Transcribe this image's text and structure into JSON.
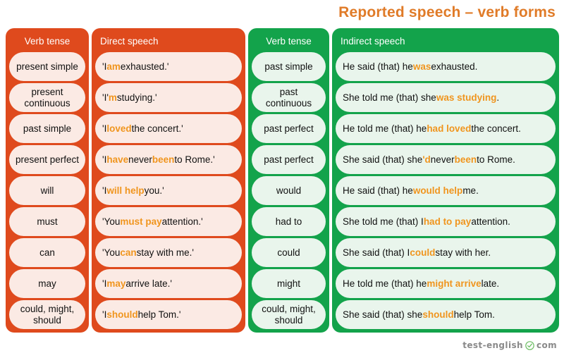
{
  "title": "Reported speech – verb forms",
  "colors": {
    "orange_panel": "#DF4A1D",
    "green_panel": "#13A34B",
    "pink_pill": "#FBEAE4",
    "mint_pill": "#E9F5EC",
    "highlight": "#F0951E",
    "title_text": "#E07B28",
    "footer_text": "#8A8A8A"
  },
  "columns": {
    "direct_tense_header": "Verb tense",
    "direct_speech_header": "Direct speech",
    "indirect_tense_header": "Verb tense",
    "indirect_speech_header": "Indirect speech"
  },
  "rows": [
    {
      "direct_tense": "present simple",
      "direct_speech": [
        {
          "t": "'I ",
          "h": false
        },
        {
          "t": "am",
          "h": true
        },
        {
          "t": " exhausted.'",
          "h": false
        }
      ],
      "indirect_tense": "past simple",
      "indirect_speech": [
        {
          "t": "He said (that) he ",
          "h": false
        },
        {
          "t": "was",
          "h": true
        },
        {
          "t": " exhausted.",
          "h": false
        }
      ]
    },
    {
      "direct_tense": "present continuous",
      "direct_speech": [
        {
          "t": "'I'",
          "h": false
        },
        {
          "t": "m",
          "h": true
        },
        {
          "t": " studying.'",
          "h": false
        }
      ],
      "indirect_tense": "past continuous",
      "indirect_speech": [
        {
          "t": "She told me (that) she ",
          "h": false
        },
        {
          "t": "was studying",
          "h": true
        },
        {
          "t": ".",
          "h": false
        }
      ]
    },
    {
      "direct_tense": "past simple",
      "direct_speech": [
        {
          "t": "'I ",
          "h": false
        },
        {
          "t": "loved",
          "h": true
        },
        {
          "t": " the concert.'",
          "h": false
        }
      ],
      "indirect_tense": "past perfect",
      "indirect_speech": [
        {
          "t": "He told me (that) he ",
          "h": false
        },
        {
          "t": "had loved",
          "h": true
        },
        {
          "t": " the concert.",
          "h": false
        }
      ]
    },
    {
      "direct_tense": "present perfect",
      "direct_speech": [
        {
          "t": "'I ",
          "h": false
        },
        {
          "t": "have",
          "h": true
        },
        {
          "t": " never ",
          "h": false
        },
        {
          "t": "been",
          "h": true
        },
        {
          "t": " to Rome.'",
          "h": false
        }
      ],
      "indirect_tense": "past perfect",
      "indirect_speech": [
        {
          "t": "She said (that) she",
          "h": false
        },
        {
          "t": "'d",
          "h": true
        },
        {
          "t": " never ",
          "h": false
        },
        {
          "t": "been",
          "h": true
        },
        {
          "t": " to Rome.",
          "h": false
        }
      ]
    },
    {
      "direct_tense": "will",
      "direct_speech": [
        {
          "t": "'I ",
          "h": false
        },
        {
          "t": "will help",
          "h": true
        },
        {
          "t": " you.'",
          "h": false
        }
      ],
      "indirect_tense": "would",
      "indirect_speech": [
        {
          "t": "He said (that) he ",
          "h": false
        },
        {
          "t": "would help",
          "h": true
        },
        {
          "t": " me.",
          "h": false
        }
      ]
    },
    {
      "direct_tense": "must",
      "direct_speech": [
        {
          "t": "'You ",
          "h": false
        },
        {
          "t": "must pay",
          "h": true
        },
        {
          "t": " attention.'",
          "h": false
        }
      ],
      "indirect_tense": "had to",
      "indirect_speech": [
        {
          "t": "She told me (that) I ",
          "h": false
        },
        {
          "t": "had to pay",
          "h": true
        },
        {
          "t": " attention.",
          "h": false
        }
      ]
    },
    {
      "direct_tense": "can",
      "direct_speech": [
        {
          "t": "'You ",
          "h": false
        },
        {
          "t": "can",
          "h": true
        },
        {
          "t": " stay with me.'",
          "h": false
        }
      ],
      "indirect_tense": "could",
      "indirect_speech": [
        {
          "t": "She said (that) I ",
          "h": false
        },
        {
          "t": "could",
          "h": true
        },
        {
          "t": " stay with her.",
          "h": false
        }
      ]
    },
    {
      "direct_tense": "may",
      "direct_speech": [
        {
          "t": "'I ",
          "h": false
        },
        {
          "t": "may",
          "h": true
        },
        {
          "t": " arrive late.'",
          "h": false
        }
      ],
      "indirect_tense": "might",
      "indirect_speech": [
        {
          "t": "He told me (that) he ",
          "h": false
        },
        {
          "t": "might arrive",
          "h": true
        },
        {
          "t": " late.",
          "h": false
        }
      ]
    },
    {
      "direct_tense": "could, might, should",
      "direct_speech": [
        {
          "t": "'I ",
          "h": false
        },
        {
          "t": "should",
          "h": true
        },
        {
          "t": " help Tom.'",
          "h": false
        }
      ],
      "indirect_tense": "could, might, should",
      "indirect_speech": [
        {
          "t": "She said (that) she ",
          "h": false
        },
        {
          "t": "should",
          "h": true
        },
        {
          "t": " help Tom.",
          "h": false
        }
      ]
    }
  ],
  "footer": {
    "brand_left": "test-english",
    "brand_right": "com",
    "check_icon": "check-circle-icon"
  }
}
